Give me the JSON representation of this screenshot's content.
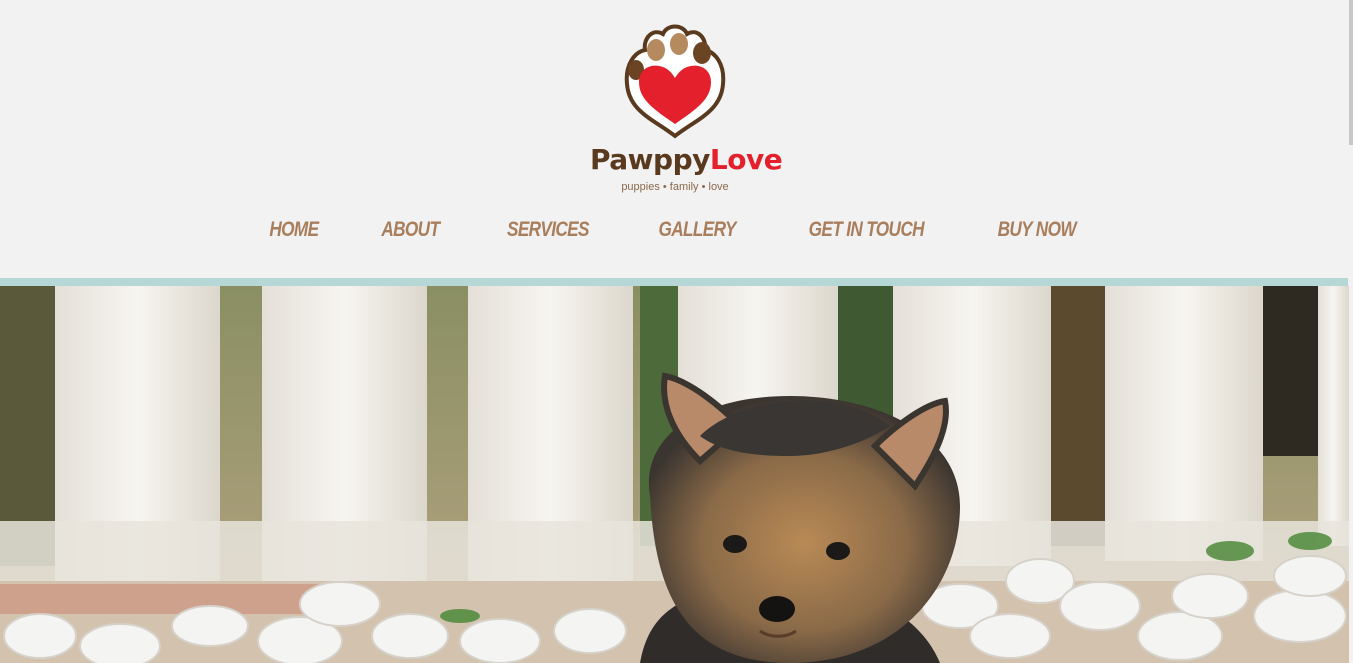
{
  "brand": {
    "name_part1": "Pawppy",
    "name_part2": "Love",
    "tagline": "puppies • family • love"
  },
  "nav": {
    "items": [
      {
        "label": "HOME"
      },
      {
        "label": "ABOUT"
      },
      {
        "label": "SERVICES"
      },
      {
        "label": "GALLERY"
      },
      {
        "label": "GET IN TOUCH"
      },
      {
        "label": "BUY NOW"
      }
    ]
  },
  "colors": {
    "background": "#f2f2f2",
    "nav_text": "#a87e5c",
    "brand_brown": "#5a3a1e",
    "brand_red": "#e3202b",
    "accent_bar": "#b5d8d6"
  },
  "icons": {
    "logo": "paw-heart-icon"
  },
  "hero": {
    "subject": "yorkshire-terrier-puppy-photo"
  }
}
